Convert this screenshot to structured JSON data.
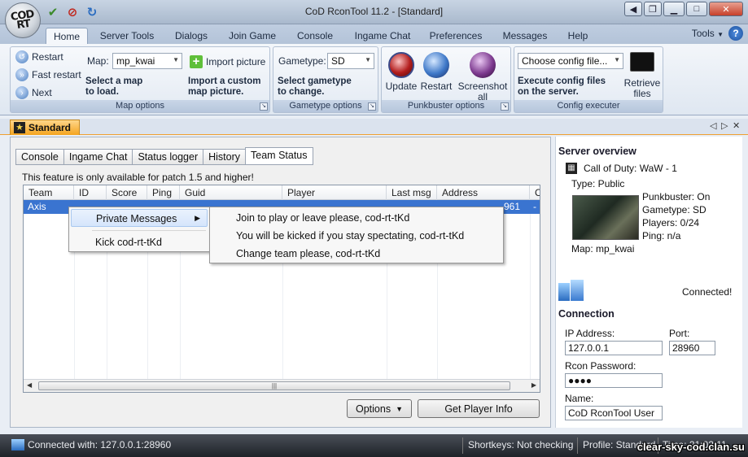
{
  "window": {
    "title": "CoD RconTool 11.2 - [Standard]",
    "logo_text": "COD RT",
    "quick_access": [
      "checkmark-icon",
      "stop-icon",
      "refresh-icon"
    ],
    "controls": [
      "back-icon",
      "restore-icon",
      "minimize-icon",
      "maximize-icon",
      "close-icon"
    ]
  },
  "ribbon_tabs": [
    "Home",
    "Server Tools",
    "Dialogs",
    "Join Game",
    "Console",
    "Ingame Chat",
    "Preferences",
    "Messages",
    "Help"
  ],
  "tools_menu": "Tools",
  "map_options": {
    "restart": "Restart",
    "fast_restart": "Fast restart",
    "next": "Next",
    "map_label": "Map:",
    "map_value": "mp_kwai",
    "select_hint_1": "Select a map",
    "select_hint_2": "to load.",
    "import_label": "Import picture",
    "import_hint_1": "Import a custom",
    "import_hint_2": "map picture.",
    "group_label": "Map options"
  },
  "gametype_options": {
    "label": "Gametype:",
    "value": "SD",
    "hint_1": "Select gametype",
    "hint_2": "to change.",
    "group_label": "Gametype options"
  },
  "punkbuster_options": {
    "update": "Update",
    "restart": "Restart",
    "screenshot_1": "Screenshot",
    "screenshot_2": "all",
    "group_label": "Punkbuster options"
  },
  "config_executer": {
    "placeholder": "Choose config file...",
    "hint_1": "Execute config files",
    "hint_2": "on the server.",
    "retrieve_1": "Retrieve",
    "retrieve_2": "files",
    "group_label": "Config executer"
  },
  "doc_tab": "Standard",
  "inner_tabs": [
    "Console",
    "Ingame Chat",
    "Status logger",
    "History",
    "Team Status"
  ],
  "notice": "This feature is only available for patch 1.5 and higher!",
  "grid": {
    "columns": [
      "Team",
      "ID",
      "Score",
      "Ping",
      "Guid",
      "Player",
      "Last msg",
      "Address",
      "C"
    ],
    "rows": [
      {
        "team": "Axis",
        "address_tail": "961",
        "c": "-"
      }
    ]
  },
  "context_menu": {
    "private_messages": "Private Messages",
    "kick": "Kick cod-rt-tKd",
    "submenu": [
      "Join to play or leave please, cod-rt-tKd",
      "You will be kicked if you stay spectating, cod-rt-tKd",
      "Change team please, cod-rt-tKd"
    ]
  },
  "buttons": {
    "options": "Options",
    "get_player_info": "Get Player Info"
  },
  "server_overview": {
    "title": "Server overview",
    "game": "Call of Duty: WaW - 1",
    "type": "Type: Public",
    "punkbuster": "Punkbuster: On",
    "gametype": "Gametype: SD",
    "players": "Players: 0/24",
    "ping": "Ping: n/a",
    "map": "Map: mp_kwai",
    "status": "Connected!"
  },
  "connection": {
    "title": "Connection",
    "ip_label": "IP Address:",
    "ip_value": "127.0.0.1",
    "port_label": "Port:",
    "port_value": "28960",
    "rcon_label": "Rcon Password:",
    "rcon_value": "●●●●",
    "name_label": "Name:",
    "name_value": "CoD RconTool User"
  },
  "statusbar": {
    "connected": "Connected with: 127.0.0.1:28960",
    "shortkeys": "Shortkeys: Not checking",
    "profile": "Profile: Standard",
    "time": "Time: 21:02:11"
  },
  "watermark": "clear-sky-cod.clan.su"
}
